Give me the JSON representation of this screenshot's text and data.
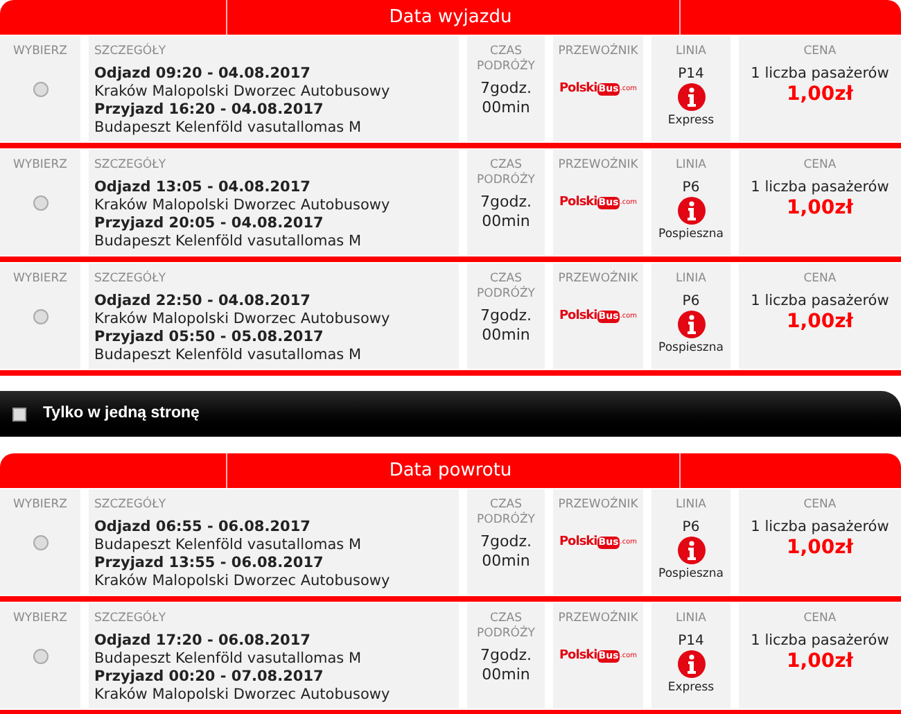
{
  "sections": [
    {
      "title": "Data wyjazdu",
      "rows": [
        {
          "headers": {
            "select": "WYBIERZ",
            "details": "SZCZEGÓŁY",
            "duration": [
              "CZAS",
              "PODRÓŻY"
            ],
            "carrier": "PRZEWOŹNIK",
            "line": "LINIA",
            "price": "CENA"
          },
          "selected": false,
          "departure": "Odjazd 09:20 - 04.08.2017",
          "from": "Kraków Malopolski Dworzec Autobusowy",
          "arrival": "Przyjazd 16:20 - 04.08.2017",
          "to": "Budapeszt Kelenföld vasutallomas M",
          "duration": [
            "7godz.",
            "00min"
          ],
          "carrier": {
            "main": "Polski",
            "badge": "Bus",
            "suffix": ".com"
          },
          "line": "P14",
          "line_type": "Express",
          "passengers": "1 liczba pasażerów",
          "price": "1,00zł"
        },
        {
          "headers": {
            "select": "WYBIERZ",
            "details": "SZCZEGÓŁY",
            "duration": [
              "CZAS",
              "PODRÓŻY"
            ],
            "carrier": "PRZEWOŹNIK",
            "line": "LINIA",
            "price": "CENA"
          },
          "selected": false,
          "departure": "Odjazd 13:05 - 04.08.2017",
          "from": "Kraków Malopolski Dworzec Autobusowy",
          "arrival": "Przyjazd 20:05 - 04.08.2017",
          "to": "Budapeszt Kelenföld vasutallomas M",
          "duration": [
            "7godz.",
            "00min"
          ],
          "carrier": {
            "main": "Polski",
            "badge": "Bus",
            "suffix": ".com"
          },
          "line": "P6",
          "line_type": "Pospieszna",
          "passengers": "1 liczba pasażerów",
          "price": "1,00zł"
        },
        {
          "headers": {
            "select": "WYBIERZ",
            "details": "SZCZEGÓŁY",
            "duration": [
              "CZAS",
              "PODRÓŻY"
            ],
            "carrier": "PRZEWOŹNIK",
            "line": "LINIA",
            "price": "CENA"
          },
          "selected": false,
          "departure": "Odjazd 22:50 - 04.08.2017",
          "from": "Kraków Malopolski Dworzec Autobusowy",
          "arrival": "Przyjazd 05:50 - 05.08.2017",
          "to": "Budapeszt Kelenföld vasutallomas M",
          "duration": [
            "7godz.",
            "00min"
          ],
          "carrier": {
            "main": "Polski",
            "badge": "Bus",
            "suffix": ".com"
          },
          "line": "P6",
          "line_type": "Pospieszna",
          "passengers": "1 liczba pasażerów",
          "price": "1,00zł"
        }
      ]
    },
    {
      "kind": "toggle",
      "label": "Tylko w jedną stronę",
      "checked": false
    },
    {
      "title": "Data powrotu",
      "rows": [
        {
          "headers": {
            "select": "WYBIERZ",
            "details": "SZCZEGÓŁY",
            "duration": [
              "CZAS",
              "PODRÓŻY"
            ],
            "carrier": "PRZEWOŹNIK",
            "line": "LINIA",
            "price": "CENA"
          },
          "selected": false,
          "departure": "Odjazd 06:55 - 06.08.2017",
          "from": "Budapeszt Kelenföld vasutallomas M",
          "arrival": "Przyjazd 13:55 - 06.08.2017",
          "to": "Kraków Malopolski Dworzec Autobusowy",
          "duration": [
            "7godz.",
            "00min"
          ],
          "carrier": {
            "main": "Polski",
            "badge": "Bus",
            "suffix": ".com"
          },
          "line": "P6",
          "line_type": "Pospieszna",
          "passengers": "1 liczba pasażerów",
          "price": "1,00zł"
        },
        {
          "headers": {
            "select": "WYBIERZ",
            "details": "SZCZEGÓŁY",
            "duration": [
              "CZAS",
              "PODRÓŻY"
            ],
            "carrier": "PRZEWOŹNIK",
            "line": "LINIA",
            "price": "CENA"
          },
          "selected": false,
          "departure": "Odjazd 17:20 - 06.08.2017",
          "from": "Budapeszt Kelenföld vasutallomas M",
          "arrival": "Przyjazd 00:20 - 07.08.2017",
          "to": "Kraków Malopolski Dworzec Autobusowy",
          "duration": [
            "7godz.",
            "00min"
          ],
          "carrier": {
            "main": "Polski",
            "badge": "Bus",
            "suffix": ".com"
          },
          "line": "P14",
          "line_type": "Express",
          "passengers": "1 liczba pasażerów",
          "price": "1,00zł"
        }
      ]
    }
  ]
}
